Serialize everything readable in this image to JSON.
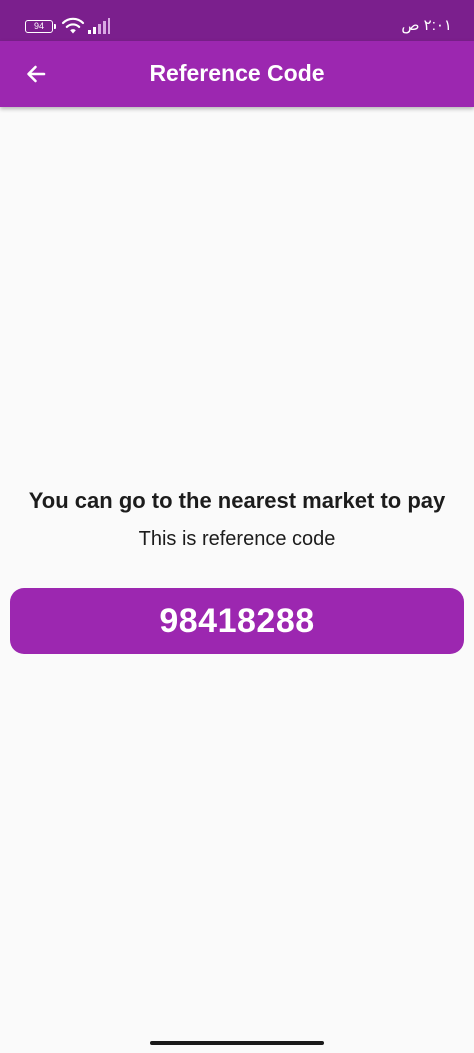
{
  "status_bar": {
    "battery_level": "94",
    "time": "٢:٠١ ص",
    "wifi_icon": "wifi-icon",
    "signal_icon": "signal-icon"
  },
  "app_bar": {
    "title": "Reference Code",
    "back_icon": "arrow-left-icon",
    "background_color": "#9c27b0"
  },
  "main": {
    "headline": "You can go to the nearest market to pay",
    "subline": "This is reference code",
    "reference_code": "98418288"
  },
  "colors": {
    "status_bar": "#7b1f8d",
    "accent": "#9c27b0",
    "background": "#fafafa"
  }
}
